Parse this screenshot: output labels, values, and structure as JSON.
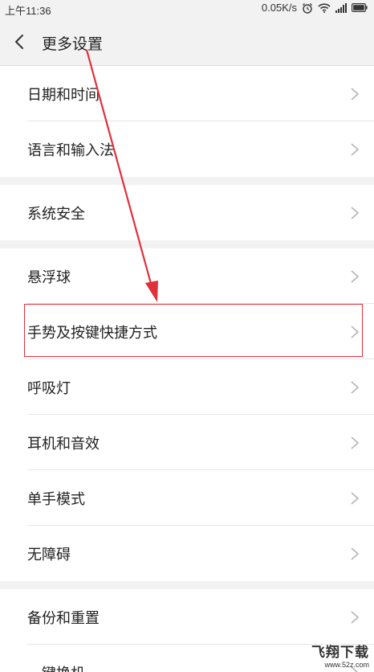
{
  "status_bar": {
    "time": "上午11:36",
    "network_speed": "0.05K/s",
    "icons": [
      "alarm-icon",
      "wifi-icon",
      "signal-icon",
      "battery-icon"
    ]
  },
  "header": {
    "title": "更多设置",
    "back_icon": "chevron-left-icon"
  },
  "groups": [
    {
      "items": [
        {
          "label": "日期和时间"
        },
        {
          "label": "语言和输入法"
        }
      ]
    },
    {
      "items": [
        {
          "label": "系统安全"
        }
      ]
    },
    {
      "items": [
        {
          "label": "悬浮球"
        },
        {
          "label": "手势及按键快捷方式",
          "highlighted": true
        },
        {
          "label": "呼吸灯"
        },
        {
          "label": "耳机和音效"
        },
        {
          "label": "单手模式"
        },
        {
          "label": "无障碍"
        }
      ]
    },
    {
      "items": [
        {
          "label": "备份和重置"
        },
        {
          "label": "一键换机"
        }
      ]
    }
  ],
  "annotation": {
    "highlight_color": "#e0303c"
  },
  "watermark": {
    "title": "飞翔下载",
    "url": "www.52z.com"
  }
}
